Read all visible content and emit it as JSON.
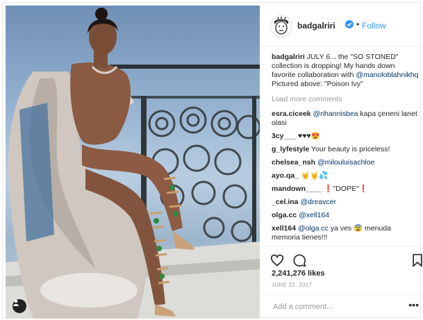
{
  "post": {
    "username": "badgalriri",
    "follow_separator": "•",
    "follow_label": "Follow",
    "caption": {
      "author": "badgalriri",
      "text": " JULY 6... the \"SO STONED\" collection is dropping! My hands down favorite collaboration with ",
      "mention": "@manoloblahnikhq",
      "text2": "Pictured above: \"Poison Ivy\""
    },
    "load_more_label": "Load more comments",
    "comments": [
      {
        "user": "esra.ciceek",
        "mention": "@rihannisbea",
        "text": " kapa çeneni lanet olasi"
      },
      {
        "user": "3cy___",
        "mention": "",
        "text": " ♥♥♥😍"
      },
      {
        "user": "g_lyfestyle",
        "mention": "",
        "text": " Your beauty is priceless!"
      },
      {
        "user": "chelsea_nsh",
        "mention": "@milouluisachloe",
        "text": ""
      },
      {
        "user": "ayo.qa_",
        "mention": "",
        "text": " 🤘🤘💦"
      },
      {
        "user": "mandown____",
        "mention": "",
        "text": " ❗️\"DOPE\"❗️"
      },
      {
        "user": "_cel.ina",
        "mention": "@dreavcer",
        "text": ""
      },
      {
        "user": "olga.cc",
        "mention": "@xell164",
        "text": ""
      },
      {
        "user": "xell164",
        "mention": "@olga.cc",
        "text": " ya ves 😨 menuda memoria tienes!!!"
      }
    ],
    "likes": "2,241,276 likes",
    "date": "JUNE 22, 2017",
    "add_comment_placeholder": "Add a comment...",
    "more_options_label": "•••"
  },
  "icons": {
    "like": "heart-icon",
    "comment": "comment-bubble-icon",
    "save": "bookmark-icon",
    "verified": "verified-badge-icon",
    "user_tag": "user-tag-icon",
    "avatar": "profile-avatar"
  },
  "colors": {
    "link": "#3897f0",
    "mention": "#003569",
    "muted": "#999999",
    "text": "#262626"
  }
}
